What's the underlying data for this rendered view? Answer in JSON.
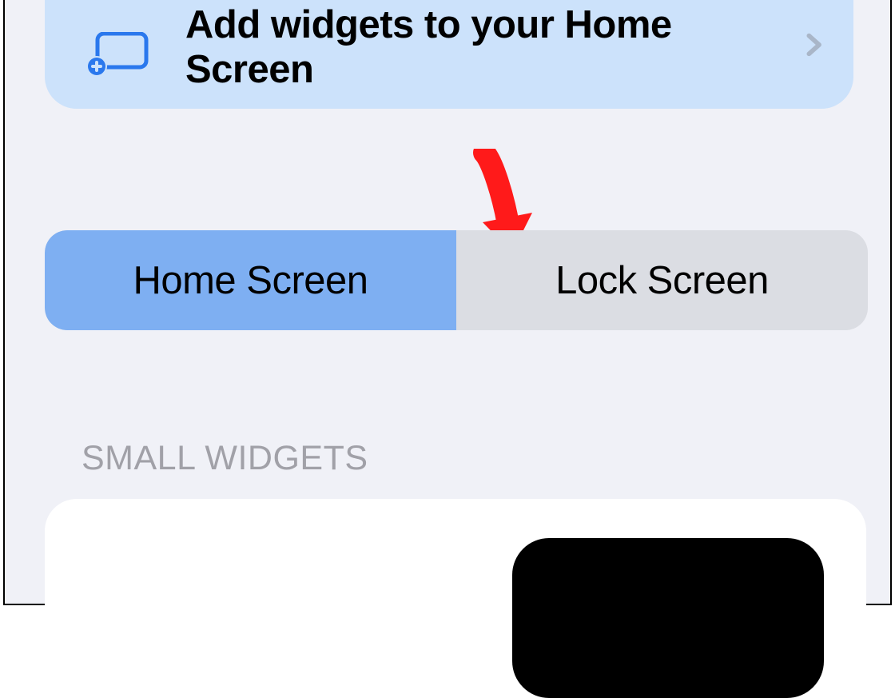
{
  "banner": {
    "title": "Add widgets to your Home Screen"
  },
  "segmented": {
    "items": [
      {
        "label": "Home Screen",
        "selected": true
      },
      {
        "label": "Lock Screen",
        "selected": false
      }
    ]
  },
  "section_header": "SMALL WIDGETS",
  "colors": {
    "banner_bg": "#cce2fb",
    "segment_selected_bg": "#7eaff2",
    "segment_bg": "#dbdde3",
    "page_bg": "#f0f1f7",
    "annotation_arrow": "#ff0000"
  },
  "icons": {
    "banner_icon": "add-widget-icon",
    "chevron": "chevron-right-icon"
  }
}
